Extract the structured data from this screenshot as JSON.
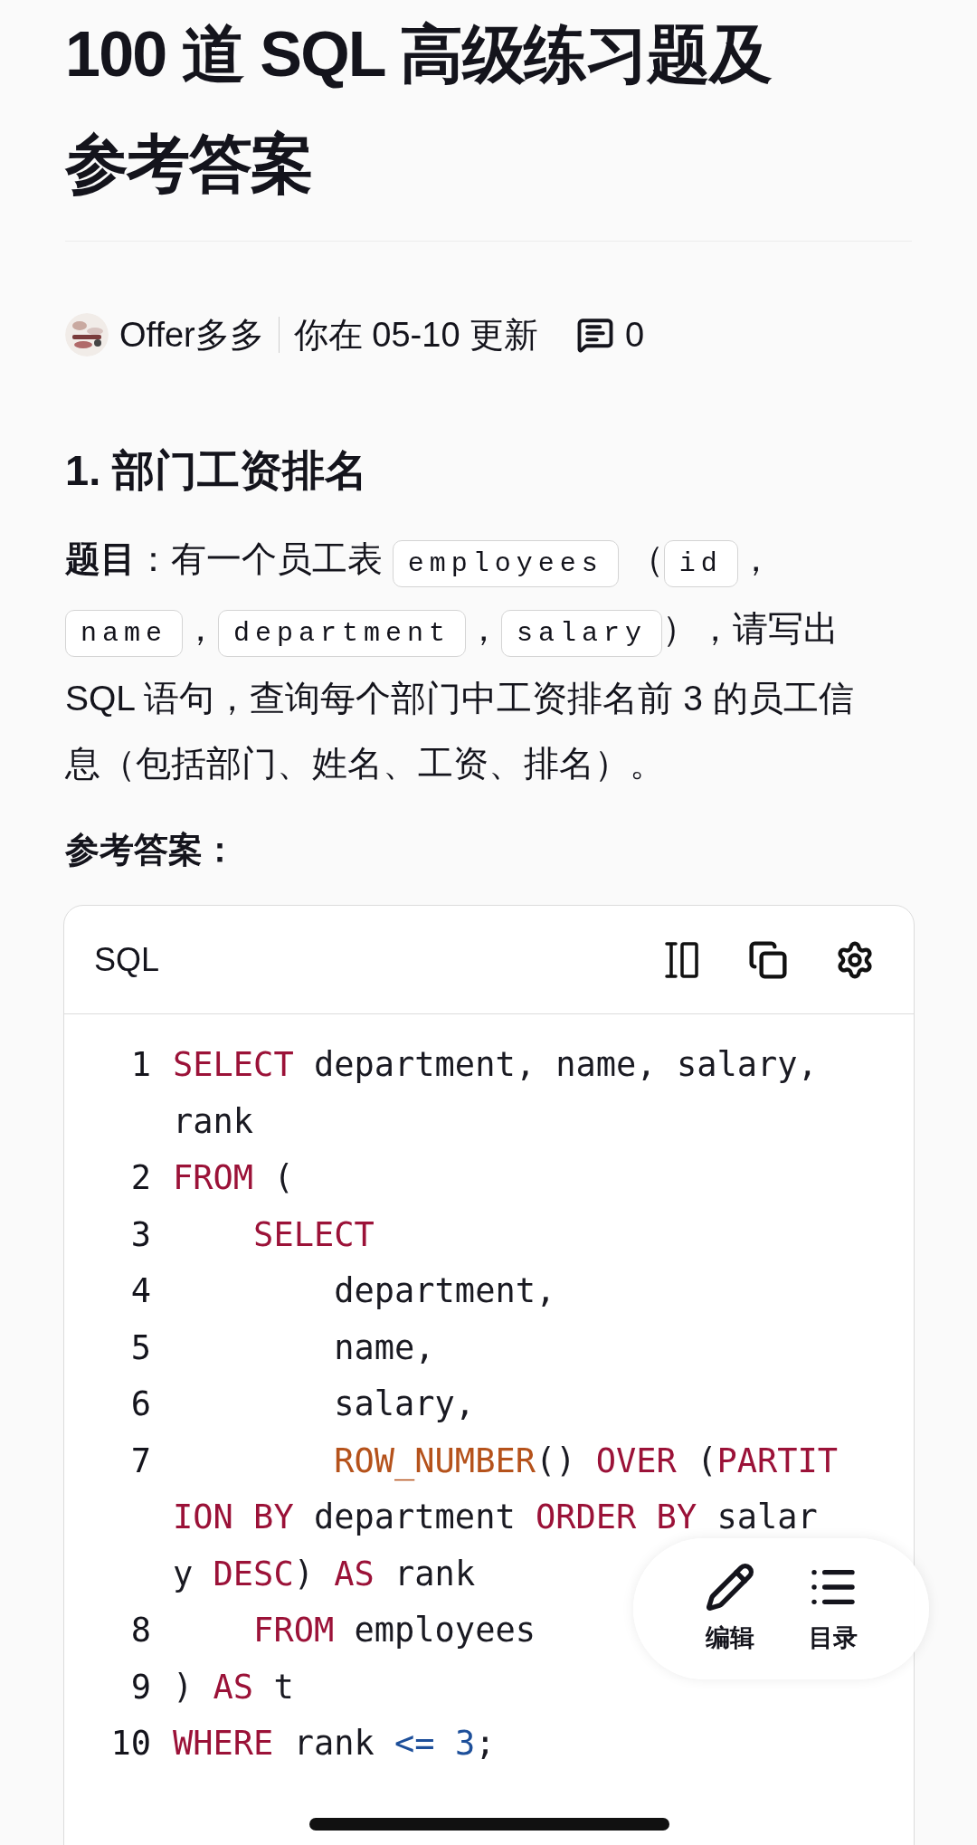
{
  "title": "100 道 SQL 高级练习题及参考答案",
  "meta": {
    "author": "Offer多多",
    "updated": "你在  05-10  更新",
    "comments": "0"
  },
  "section": {
    "heading": "1. 部门工资排名",
    "question": [
      {
        "kind": "bold",
        "text": "题目"
      },
      {
        "kind": "text",
        "text": "：有一个员工表 "
      },
      {
        "kind": "code",
        "text": "employees"
      },
      {
        "kind": "text",
        "text": " （"
      },
      {
        "kind": "code",
        "text": "id"
      },
      {
        "kind": "text",
        "text": "，"
      },
      {
        "kind": "code",
        "text": "name"
      },
      {
        "kind": "text",
        "text": "，"
      },
      {
        "kind": "code",
        "text": "department"
      },
      {
        "kind": "text",
        "text": "，"
      },
      {
        "kind": "code",
        "text": "salary"
      },
      {
        "kind": "text",
        "text": "），请写出 SQL 语句，查询每个部门中工资排名前 3 的员工信息（包括部门、姓名、工资、排名）。"
      }
    ],
    "answer_label": "参考答案："
  },
  "code_block": {
    "language": "SQL",
    "lines": [
      {
        "number": "1",
        "rows": [
          {
            "segments": [
              {
                "kind": "keyword",
                "text": "SELECT"
              },
              {
                "kind": "plain",
                "text": " department, name, salary,"
              }
            ]
          },
          {
            "segments": [
              {
                "kind": "plain",
                "text": "rank"
              }
            ]
          }
        ]
      },
      {
        "number": "2",
        "rows": [
          {
            "segments": [
              {
                "kind": "keyword",
                "text": "FROM"
              },
              {
                "kind": "plain",
                "text": " ("
              }
            ]
          }
        ]
      },
      {
        "number": "3",
        "rows": [
          {
            "segments": [
              {
                "kind": "keyword",
                "text": "    SELECT"
              }
            ]
          }
        ]
      },
      {
        "number": "4",
        "rows": [
          {
            "segments": [
              {
                "kind": "plain",
                "text": "        department,"
              }
            ]
          }
        ]
      },
      {
        "number": "5",
        "rows": [
          {
            "segments": [
              {
                "kind": "plain",
                "text": "        name,"
              }
            ]
          }
        ]
      },
      {
        "number": "6",
        "rows": [
          {
            "segments": [
              {
                "kind": "plain",
                "text": "        salary,"
              }
            ]
          }
        ]
      },
      {
        "number": "7",
        "rows": [
          {
            "segments": [
              {
                "kind": "function",
                "text": "        ROW_NUMBER"
              },
              {
                "kind": "plain",
                "text": "() "
              },
              {
                "kind": "keyword",
                "text": "OVER"
              },
              {
                "kind": "plain",
                "text": " ("
              },
              {
                "kind": "keyword",
                "text": "PARTIT"
              }
            ]
          },
          {
            "segments": [
              {
                "kind": "keyword",
                "text": "ION BY"
              },
              {
                "kind": "plain",
                "text": " department "
              },
              {
                "kind": "keyword",
                "text": "ORDER BY"
              },
              {
                "kind": "plain",
                "text": " salar"
              }
            ]
          },
          {
            "segments": [
              {
                "kind": "plain",
                "text": "y "
              },
              {
                "kind": "keyword",
                "text": "DESC"
              },
              {
                "kind": "plain",
                "text": ") "
              },
              {
                "kind": "keyword",
                "text": "AS"
              },
              {
                "kind": "plain",
                "text": " rank"
              }
            ]
          }
        ]
      },
      {
        "number": "8",
        "rows": [
          {
            "segments": [
              {
                "kind": "keyword",
                "text": "    FROM"
              },
              {
                "kind": "plain",
                "text": " employees"
              }
            ]
          }
        ]
      },
      {
        "number": "9",
        "rows": [
          {
            "segments": [
              {
                "kind": "plain",
                "text": ") "
              },
              {
                "kind": "keyword",
                "text": "AS"
              },
              {
                "kind": "plain",
                "text": " t"
              }
            ]
          }
        ]
      },
      {
        "number": "10",
        "rows": [
          {
            "segments": [
              {
                "kind": "keyword",
                "text": "WHERE"
              },
              {
                "kind": "plain",
                "text": " rank "
              },
              {
                "kind": "operator",
                "text": "<= "
              },
              {
                "kind": "number",
                "text": "3"
              },
              {
                "kind": "plain",
                "text": ";"
              }
            ]
          }
        ]
      }
    ]
  },
  "floating_actions": [
    {
      "kind": "edit",
      "label": "编辑"
    },
    {
      "kind": "toc",
      "label": "目录"
    }
  ]
}
